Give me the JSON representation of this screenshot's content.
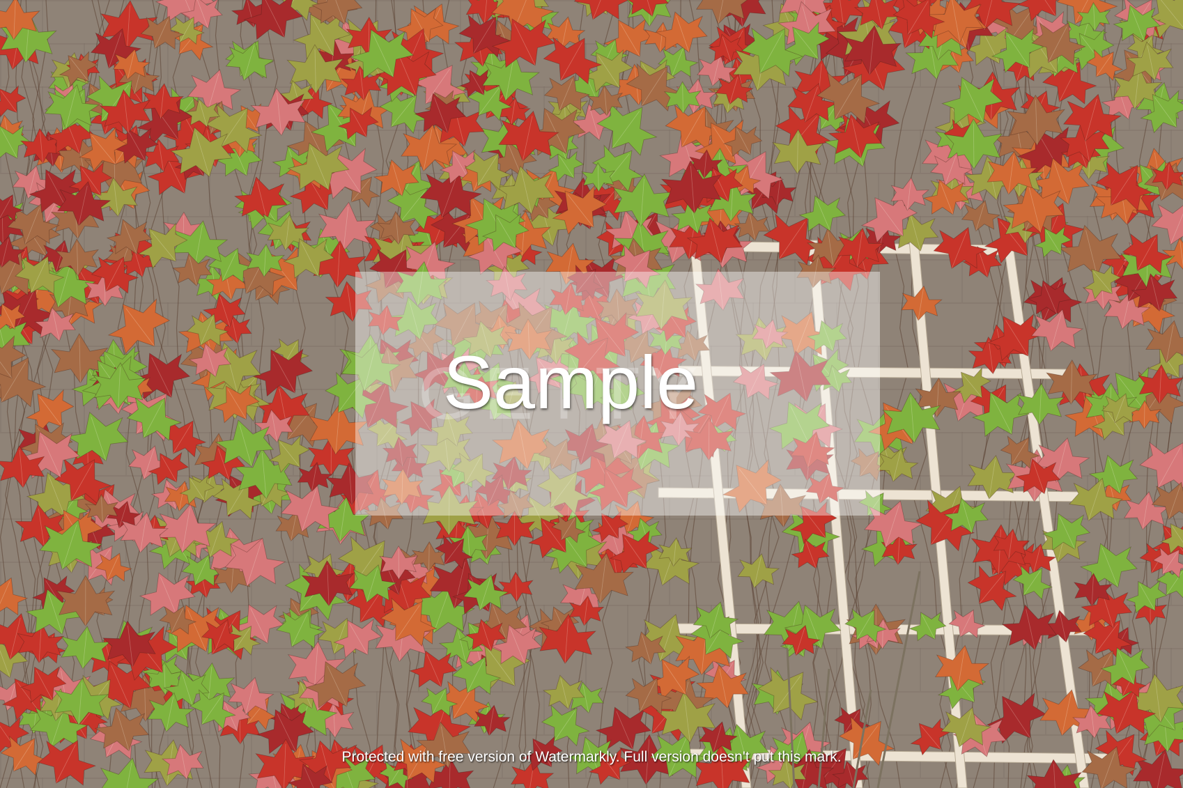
{
  "watermark": {
    "sample_text": "Sample",
    "ghost_text": "GETTY",
    "footer_text": "Protected with free version of Watermarkly. Full version doesn't put this mark."
  },
  "palette": {
    "wall": "#8f8377",
    "wall_shadow": "#7a6e63",
    "trellis": "#ede3d3",
    "leaf_red": "#c8342a",
    "leaf_crimson": "#a82a2c",
    "leaf_orange": "#d36a35",
    "leaf_pink": "#d7787a",
    "leaf_green": "#7fb33f",
    "leaf_olive": "#9fa146",
    "leaf_bronze": "#a56b46",
    "stem": "#5a4032"
  }
}
